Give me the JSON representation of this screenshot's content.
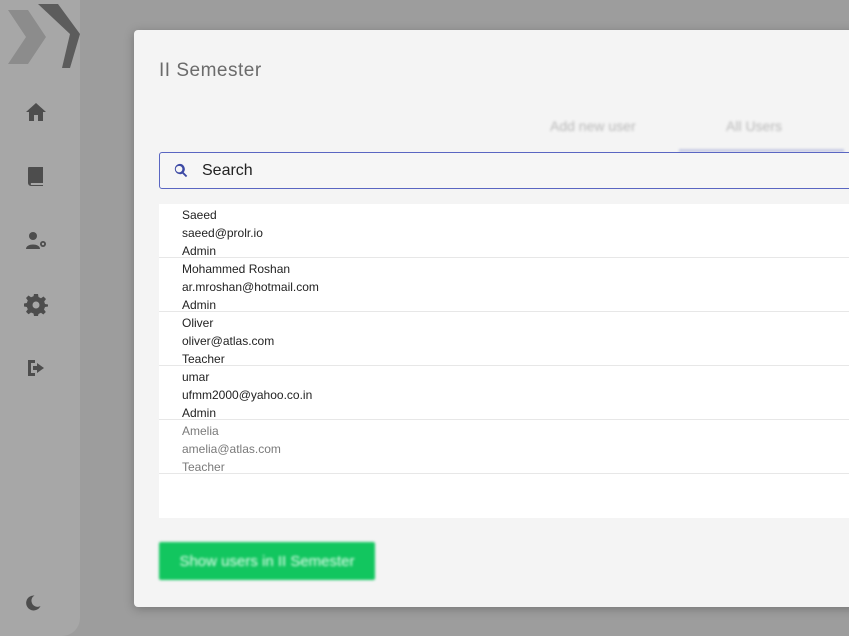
{
  "modal": {
    "title": "II Semester",
    "tabs": [
      {
        "label": "Add new user"
      },
      {
        "label": "All Users"
      }
    ],
    "search": {
      "placeholder": "Search"
    },
    "users": [
      {
        "name": "Saeed",
        "email": "saeed@prolr.io",
        "role": "Admin"
      },
      {
        "name": "Mohammed Roshan",
        "email": "ar.mroshan@hotmail.com",
        "role": "Admin"
      },
      {
        "name": "Oliver",
        "email": "oliver@atlas.com",
        "role": "Teacher"
      },
      {
        "name": "umar",
        "email": "ufmm2000@yahoo.co.in",
        "role": "Admin"
      },
      {
        "name": "Amelia",
        "email": "amelia@atlas.com",
        "role": "Teacher"
      }
    ],
    "show_button": "Show users in II Semester"
  },
  "sidebar": {
    "icons": [
      "home-icon",
      "book-icon",
      "users-cog-icon",
      "gear-icon",
      "sign-out-icon"
    ],
    "theme_icon": "moon-icon"
  },
  "colors": {
    "accent": "#3d4aa5",
    "button": "#12c65f"
  }
}
